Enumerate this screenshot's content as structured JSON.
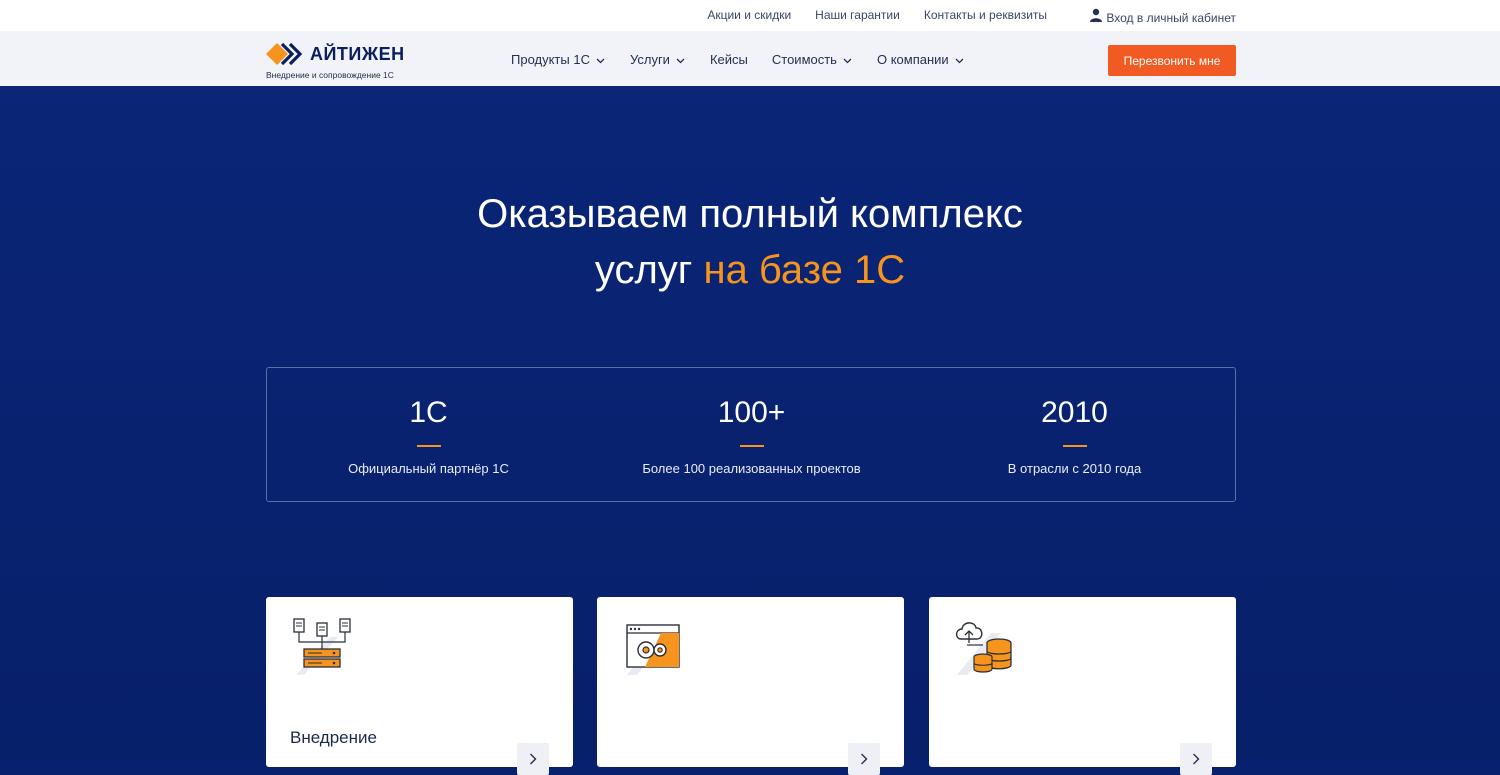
{
  "topbar": {
    "links": [
      "Акции и скидки",
      "Наши гарантии",
      "Контакты и реквизиты"
    ],
    "login_label": "Вход в личный кабинет"
  },
  "header": {
    "brand": "АЙТИЖЕН",
    "tagline": "Внедрение и сопровождение 1С",
    "nav": [
      {
        "label": "Продукты 1С",
        "has_dropdown": true
      },
      {
        "label": "Услуги",
        "has_dropdown": true
      },
      {
        "label": "Кейсы",
        "has_dropdown": false
      },
      {
        "label": "Стоимость",
        "has_dropdown": true
      },
      {
        "label": "О компании",
        "has_dropdown": true
      }
    ],
    "cta_label": "Перезвонить мне"
  },
  "hero": {
    "title_line1": "Оказываем полный комплекс",
    "title_line2_prefix": "услуг ",
    "title_line2_accent": "на базе 1С"
  },
  "stats": [
    {
      "value": "1С",
      "description": "Официальный партнёр 1С"
    },
    {
      "value": "100+",
      "description": "Более 100 реализованных проектов"
    },
    {
      "value": "2010",
      "description": "В отрасли с 2010 года"
    }
  ],
  "cards": [
    {
      "title": "Внедрение",
      "icon": "servers-icon"
    },
    {
      "title": "",
      "icon": "gears-window-icon"
    },
    {
      "title": "",
      "icon": "cloud-database-icon"
    }
  ],
  "colors": {
    "accent": "#f7941d",
    "cta": "#f15a22",
    "hero_bg": "#0b2577",
    "brand_dark": "#0a1f5c"
  }
}
